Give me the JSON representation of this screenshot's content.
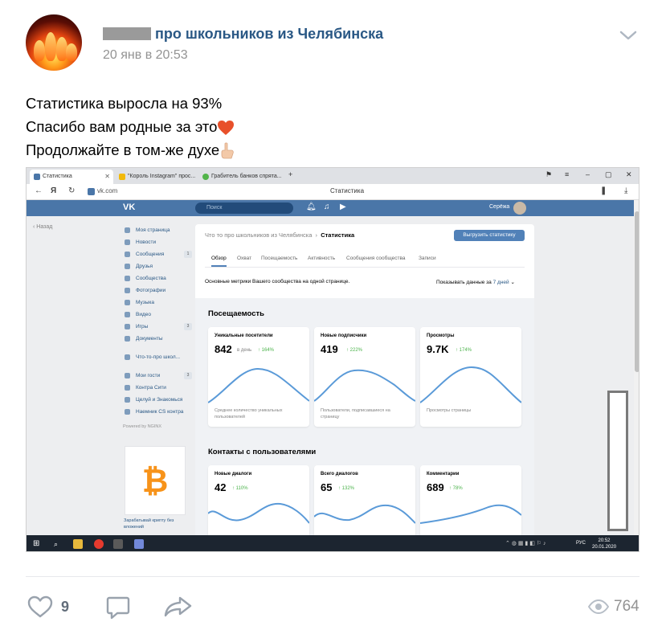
{
  "post": {
    "author_suffix": "про школьников из Челябинска",
    "date": "20 янв в 20:53",
    "lines": [
      "Статистика выросла на 93%",
      "Спасибо вам родные за это",
      "Продолжайте в том-же духе"
    ],
    "emoji": [
      "heart",
      "pointing-up"
    ]
  },
  "browser": {
    "tabs": [
      "Статистика",
      "\"Король Instagram\" прос...",
      "Грабитель банков спрята..."
    ],
    "url": "vk.com",
    "page_title": "Статистика"
  },
  "vk": {
    "logo": "VK",
    "search_placeholder": "Поиск",
    "user_name": "Серёжа",
    "back": "Назад",
    "menu": [
      {
        "label": "Моя страница",
        "count": ""
      },
      {
        "label": "Новости",
        "count": ""
      },
      {
        "label": "Сообщения",
        "count": "1"
      },
      {
        "label": "Друзья",
        "count": ""
      },
      {
        "label": "Сообщества",
        "count": ""
      },
      {
        "label": "Фотографии",
        "count": ""
      },
      {
        "label": "Музыка",
        "count": ""
      },
      {
        "label": "Видео",
        "count": ""
      },
      {
        "label": "Игры",
        "count": "3"
      },
      {
        "label": "Документы",
        "count": ""
      }
    ],
    "menu2": [
      {
        "label": "Что-то-про школ..."
      }
    ],
    "menu3": [
      {
        "label": "Мои гости",
        "count": "3"
      },
      {
        "label": "Контра Сити",
        "count": ""
      },
      {
        "label": "Целуй и Знакомься",
        "count": ""
      },
      {
        "label": "Наемник CS контра",
        "count": ""
      }
    ],
    "powered": "Powered by NGINX",
    "ad_text": "Зарабатывай крипту без вложений",
    "breadcrumb_group": "Что то про школьников из Челябинска",
    "breadcrumb_page": "Статистика",
    "export_button": "Выгрузить статистику",
    "stat_tabs": [
      "Обзор",
      "Охват",
      "Посещаемость",
      "Активность",
      "Сообщения сообщества",
      "Записи"
    ],
    "metrics_note": "Основные метрики Вашего сообщества на одной странице.",
    "period_prefix": "Показывать данные за",
    "period_value": "7 дней",
    "section1": "Посещаемость",
    "section2": "Контакты с пользователями",
    "cards1": [
      {
        "title": "Уникальные посетители",
        "value": "842",
        "unit": "в день",
        "growth": "↑ 164%",
        "desc": "Среднее количество уникальных пользователей"
      },
      {
        "title": "Новые подписчики",
        "value": "419",
        "unit": "",
        "growth": "↑ 222%",
        "desc": "Пользователи, подписавшиеся на страницу"
      },
      {
        "title": "Просмотры",
        "value": "9.7K",
        "unit": "",
        "growth": "↑ 174%",
        "desc": "Просмотры страницы"
      }
    ],
    "cards2": [
      {
        "title": "Новые диалоги",
        "value": "42",
        "growth": "↑ 110%"
      },
      {
        "title": "Всего диалогов",
        "value": "65",
        "growth": "↑ 132%"
      },
      {
        "title": "Комментарии",
        "value": "689",
        "growth": "↑ 78%"
      }
    ]
  },
  "taskbar": {
    "lang": "РУС",
    "time": "20:52",
    "date": "20.01.2020"
  },
  "footer": {
    "likes": "9",
    "views": "764"
  },
  "colors": {
    "link": "#2a5885",
    "vk_blue": "#4a76a8",
    "growth": "#4bb34b"
  }
}
